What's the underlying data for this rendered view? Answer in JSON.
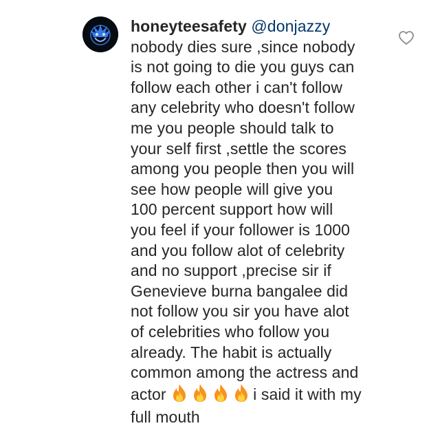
{
  "comment": {
    "username": "honeyteesafety",
    "mention": "@donjazzy",
    "lines": [
      "nobody dies sure ,since nobody",
      "is not going to die you guys can",
      "follow each other  i can't follow",
      "any celebrity who doesn't follow",
      "me you people should talk to",
      "your self first ,settle the scores",
      "among you people then you will",
      "see how people will give you",
      "100 percent support how will",
      "you feel if your follower is 1000",
      "and you follow alot of celebrity",
      "and no support ,precise sir if",
      "Genevieve burna bangalee did",
      "not follow you sir you have alot",
      "of celebrities who follow you",
      "already. The habit is actually",
      "common among the actress and"
    ],
    "last_line_start": "actor",
    "last_line_end": "i said it with my",
    "final_line": "full mouth",
    "emoji_count": 4
  },
  "icons": {
    "avatar": "profile-avatar",
    "emoji": "fire-emoji",
    "like": "heart-outline-icon"
  },
  "colors": {
    "text": "#262626",
    "mention": "#00376b",
    "like_outline": "#8e8e8e",
    "fire_outer": "#f7931e",
    "fire_inner": "#ffd23f"
  }
}
